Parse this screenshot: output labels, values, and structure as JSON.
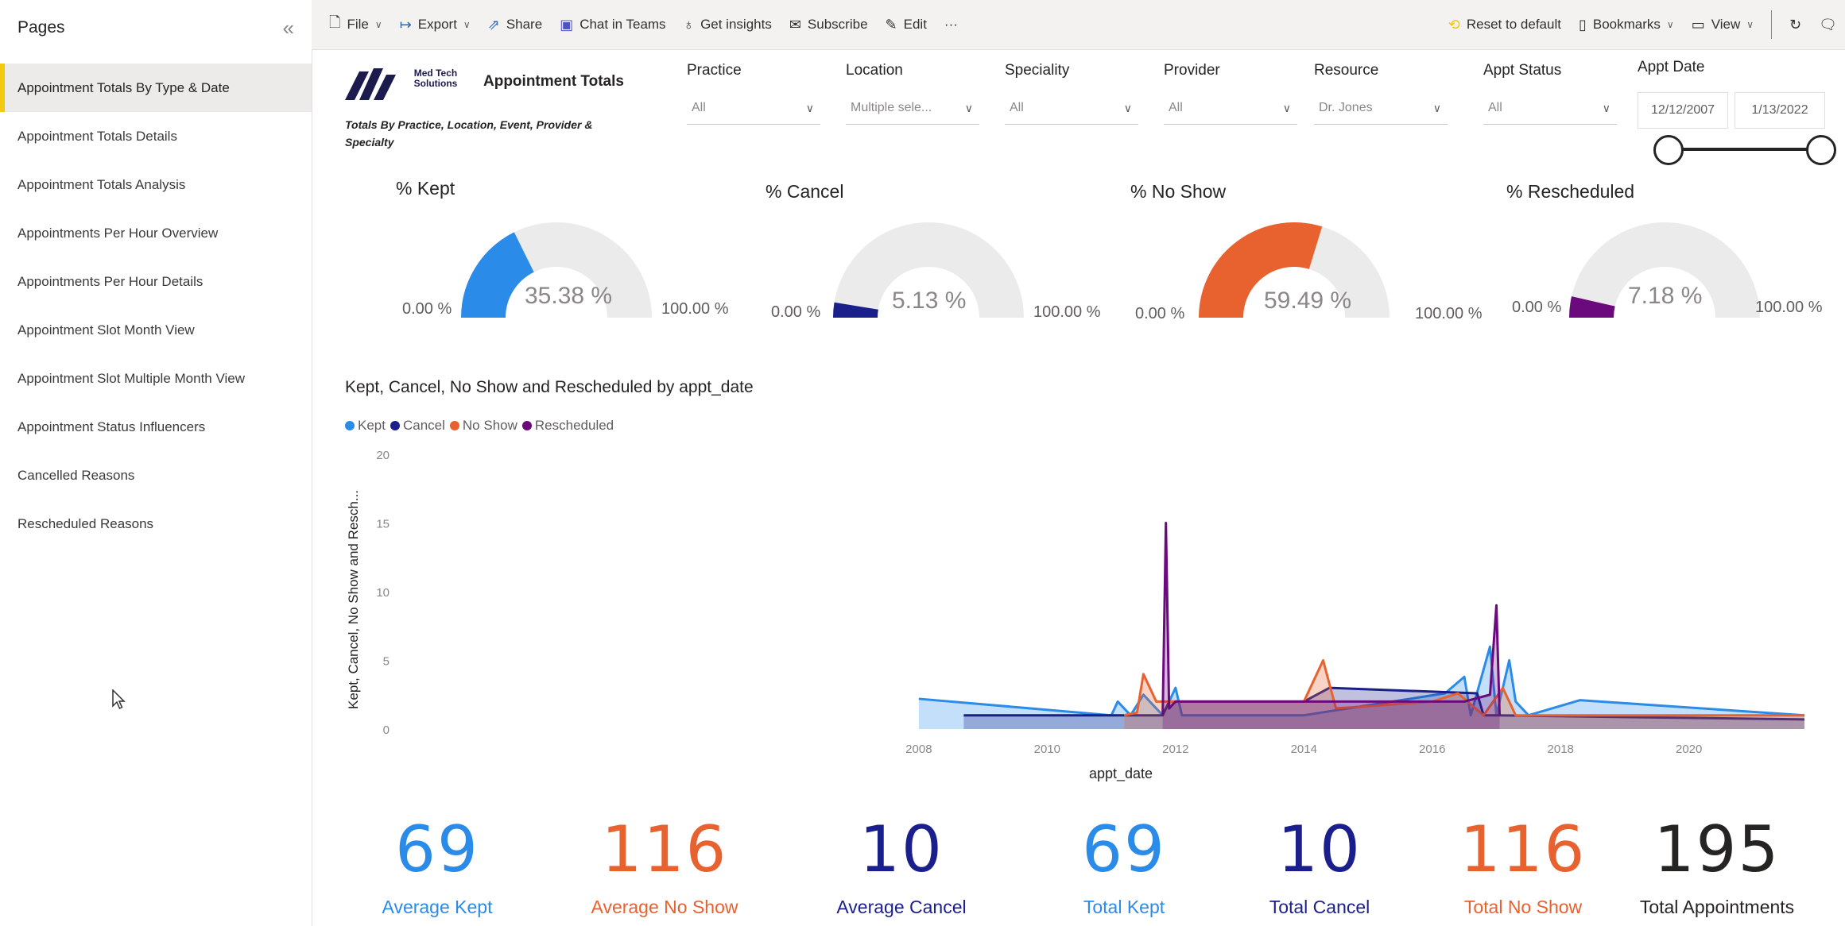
{
  "sidebar": {
    "title": "Pages",
    "pages": [
      "Appointment Totals By Type & Date",
      "Appointment Totals Details",
      "Appointment Totals Analysis",
      "Appointments Per Hour Overview",
      "Appointments Per Hour Details",
      "Appointment Slot Month View",
      "Appointment Slot Multiple Month View",
      "Appointment Status Influencers",
      "Cancelled Reasons",
      "Rescheduled Reasons"
    ],
    "active_index": 0
  },
  "toolbar": {
    "file": "File",
    "export": "Export",
    "share": "Share",
    "chat": "Chat in Teams",
    "insights": "Get insights",
    "subscribe": "Subscribe",
    "edit": "Edit",
    "more": "···",
    "reset": "Reset to default",
    "bookmarks": "Bookmarks",
    "view": "View"
  },
  "header": {
    "company": "Med Tech Solutions",
    "title": "Appointment Totals",
    "subtitle": "Totals By Practice, Location, Event, Provider & Specialty"
  },
  "slicers": [
    {
      "label": "Practice",
      "value": "All"
    },
    {
      "label": "Location",
      "value": "Multiple sele..."
    },
    {
      "label": "Speciality",
      "value": "All"
    },
    {
      "label": "Provider",
      "value": "All"
    },
    {
      "label": "Resource",
      "value": "Dr. Jones"
    },
    {
      "label": "Appt Status",
      "value": "All"
    }
  ],
  "date_slicer": {
    "label": "Appt Date",
    "start": "12/12/2007",
    "end": "1/13/2022"
  },
  "gauges": [
    {
      "title": "% Kept",
      "value_text": "35.38 %",
      "min": "0.00 %",
      "max": "100.00 %",
      "value": 35.38,
      "color": "#2b8be8"
    },
    {
      "title": "% Cancel",
      "value_text": "5.13 %",
      "min": "0.00 %",
      "max": "100.00 %",
      "value": 5.13,
      "color": "#1a1f8c"
    },
    {
      "title": "% No Show",
      "value_text": "59.49 %",
      "min": "0.00 %",
      "max": "100.00 %",
      "value": 59.49,
      "color": "#e8622f"
    },
    {
      "title": "% Rescheduled",
      "value_text": "7.18 %",
      "min": "0.00 %",
      "max": "100.00 %",
      "value": 7.18,
      "color": "#6b0a7d"
    }
  ],
  "chart_data": {
    "type": "area",
    "title": "Kept, Cancel, No Show and Rescheduled by appt_date",
    "xlabel": "appt_date",
    "ylabel": "Kept, Cancel, No Show and Resch...",
    "xlim": [
      2000,
      2021.8
    ],
    "ylim": [
      0,
      20
    ],
    "x_ticks": [
      2008,
      2010,
      2012,
      2014,
      2016,
      2018,
      2020
    ],
    "y_ticks": [
      0,
      5,
      10,
      15,
      20
    ],
    "legend": "top-left",
    "series": [
      {
        "name": "Kept",
        "color": "#2b8be8",
        "points": [
          [
            2008,
            2.2
          ],
          [
            2011,
            1
          ],
          [
            2011.1,
            2
          ],
          [
            2011.3,
            1
          ],
          [
            2011.5,
            2.5
          ],
          [
            2011.8,
            1
          ],
          [
            2012,
            3
          ],
          [
            2012.1,
            1
          ],
          [
            2014,
            1
          ],
          [
            2016.2,
            2.6
          ],
          [
            2016.5,
            3.8
          ],
          [
            2016.6,
            1
          ],
          [
            2016.9,
            6
          ],
          [
            2017,
            1
          ],
          [
            2017.2,
            5
          ],
          [
            2017.3,
            2
          ],
          [
            2017.5,
            1
          ],
          [
            2018.3,
            2.1
          ],
          [
            2021.8,
            1
          ]
        ]
      },
      {
        "name": "Cancel",
        "color": "#1a1f8c",
        "points": [
          [
            2008.7,
            1
          ],
          [
            2011.8,
            1
          ],
          [
            2011.9,
            2
          ],
          [
            2014,
            2
          ],
          [
            2014.4,
            3
          ],
          [
            2016.7,
            2.6
          ],
          [
            2016.8,
            1
          ],
          [
            2017,
            1
          ],
          [
            2021.8,
            0.7
          ]
        ]
      },
      {
        "name": "No Show",
        "color": "#e8622f",
        "points": [
          [
            2011.2,
            1
          ],
          [
            2011.4,
            1.2
          ],
          [
            2011.5,
            4
          ],
          [
            2011.7,
            2
          ],
          [
            2012,
            2
          ],
          [
            2014,
            2
          ],
          [
            2014.3,
            5
          ],
          [
            2014.5,
            1.5
          ],
          [
            2016,
            2
          ],
          [
            2016.4,
            2.6
          ],
          [
            2016.8,
            1
          ],
          [
            2017.1,
            3
          ],
          [
            2017.3,
            1
          ],
          [
            2021.8,
            1
          ]
        ]
      },
      {
        "name": "Rescheduled",
        "color": "#6b0a7d",
        "points": [
          [
            2011.8,
            1
          ],
          [
            2011.85,
            15
          ],
          [
            2011.9,
            1.5
          ],
          [
            2012,
            2
          ],
          [
            2016.5,
            2
          ],
          [
            2016.9,
            2.5
          ],
          [
            2017,
            9
          ],
          [
            2017.05,
            1
          ]
        ]
      }
    ]
  },
  "cards": [
    {
      "value": "69",
      "label": "Average Kept",
      "color": "#2b8be8"
    },
    {
      "value": "116",
      "label": "Average No Show",
      "color": "#e8622f"
    },
    {
      "value": "10",
      "label": "Average Cancel",
      "color": "#1a1f8c"
    },
    {
      "value": "69",
      "label": "Total Kept",
      "color": "#2b8be8"
    },
    {
      "value": "10",
      "label": "Total Cancel",
      "color": "#1a1f8c"
    },
    {
      "value": "116",
      "label": "Total No Show",
      "color": "#e8622f"
    },
    {
      "value": "195",
      "label": "Total Appointments",
      "color": "#252423"
    }
  ]
}
